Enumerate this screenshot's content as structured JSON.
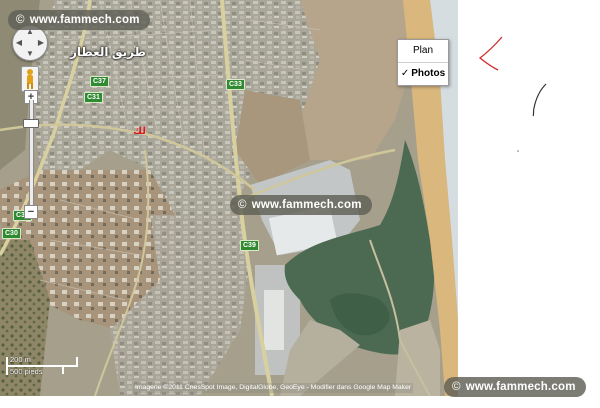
{
  "watermark": {
    "text": "www.fammech.com",
    "copyright_symbol": "©"
  },
  "map_type": {
    "options": [
      {
        "label": "Plan",
        "selected": false
      },
      {
        "label": "Photos",
        "selected": true
      }
    ],
    "check_mark": "✓"
  },
  "labels": {
    "place_name": "طريق العطار",
    "poi_marker": "لك"
  },
  "road_badges": [
    "C37",
    "C33",
    "C31",
    "C31",
    "C30",
    "C39"
  ],
  "controls": {
    "zoom_in": "+",
    "zoom_out": "−",
    "pan_up": "▲",
    "pan_left": "◀",
    "pan_right": "▶",
    "pan_down": "▼"
  },
  "scale": {
    "metric": "200 m",
    "imperial": "500 pieds"
  },
  "attribution": {
    "imagery": "Imagerie ©2011 CnesSpot Image, DigitalGlobe, GeoEye -",
    "link": "Modifier dans Google Map Maker"
  },
  "colors": {
    "urban": "#a9a69a",
    "bare_land": "#b19f86",
    "beach": "#d9b77d",
    "lagoon": "#4c6a52",
    "sea": "#d5dde0",
    "highway": "#d9d0a0",
    "road_badge": "#2f8a32",
    "scribble": "#d22a2a"
  }
}
